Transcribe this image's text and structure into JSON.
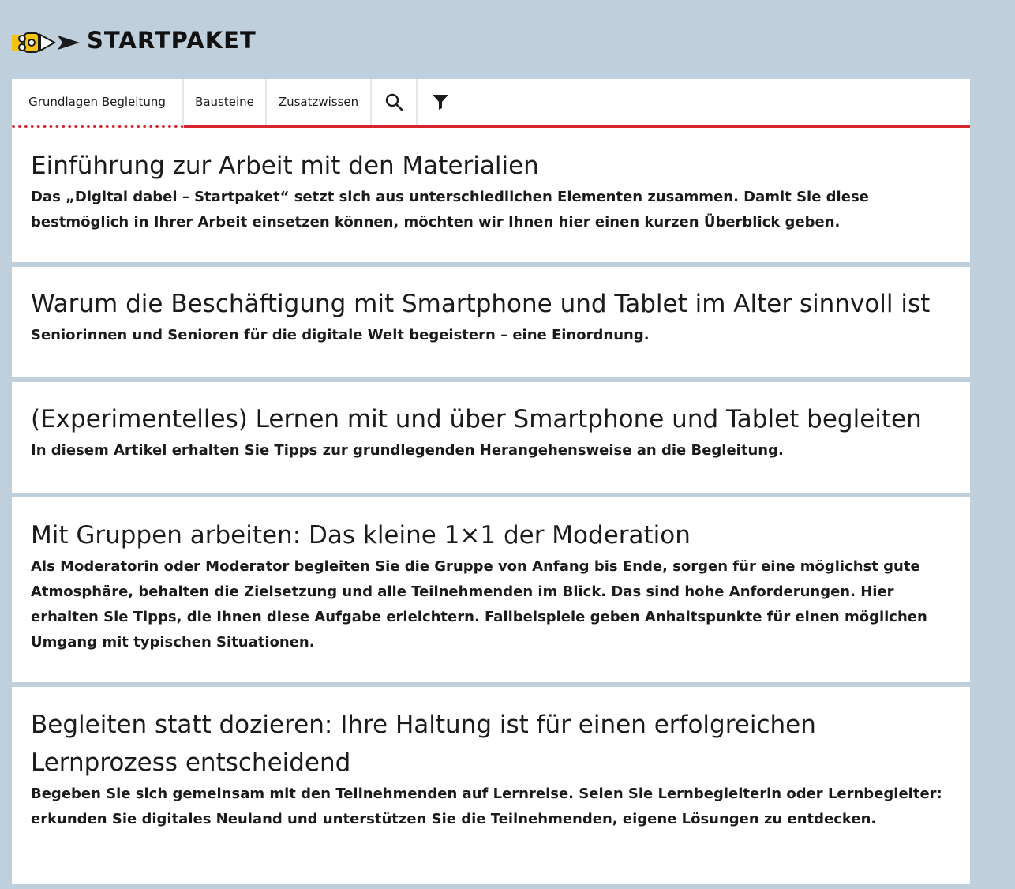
{
  "header": {
    "brand": "STARTPAKET",
    "logo_colors": {
      "yellow": "#f2c40f",
      "dark": "#1b1b1b"
    }
  },
  "tabs": [
    {
      "label": "Grundlagen Begleitung",
      "active": true
    },
    {
      "label": "Bausteine",
      "active": false
    },
    {
      "label": "Zusatzwissen",
      "active": false
    }
  ],
  "tab_icons": [
    {
      "icon": "search-icon"
    },
    {
      "icon": "filter-icon"
    }
  ],
  "accent_color": "#d9262e",
  "articles": [
    {
      "title": "Einführung zur Arbeit mit den Materialien",
      "teaser": "Das „Digital dabei – Startpaket“ setzt sich aus unterschiedlichen Elementen zusammen. Damit Sie diese bestmöglich in Ihrer Arbeit einsetzen können, möchten wir Ihnen hier einen kurzen Überblick geben."
    },
    {
      "title": "Warum die Beschäftigung mit Smartphone und Tablet im Alter sinnvoll ist",
      "teaser": "Seniorinnen und Senioren für die digitale Welt begeistern – eine Einordnung."
    },
    {
      "title": "(Experimentelles) Lernen mit und über Smartphone und Tablet begleiten",
      "teaser": "In diesem Artikel erhalten Sie Tipps zur grundlegenden Herangehensweise an die Begleitung."
    },
    {
      "title": "Mit Gruppen arbeiten: Das kleine 1×1 der Moderation",
      "teaser": "Als Moderatorin oder Moderator begleiten Sie die Gruppe von Anfang bis Ende, sorgen für eine möglichst gute Atmosphäre, behalten die Zielsetzung und alle Teilnehmenden im Blick. Das sind hohe Anforderungen. Hier erhalten Sie Tipps, die Ihnen diese Aufgabe erleichtern. Fallbeispiele geben Anhaltspunkte für einen möglichen Umgang mit typischen Situationen."
    },
    {
      "title": "Begleiten statt dozieren: Ihre Haltung ist für einen erfolgreichen Lernprozess entscheidend",
      "teaser": "Begeben Sie sich gemeinsam mit den Teilnehmenden auf Lernreise. Seien Sie Lernbegleiterin oder Lernbegleiter: erkunden Sie digitales Neuland und unterstützen Sie die Teilnehmenden, eigene Lösungen zu entdecken."
    }
  ]
}
